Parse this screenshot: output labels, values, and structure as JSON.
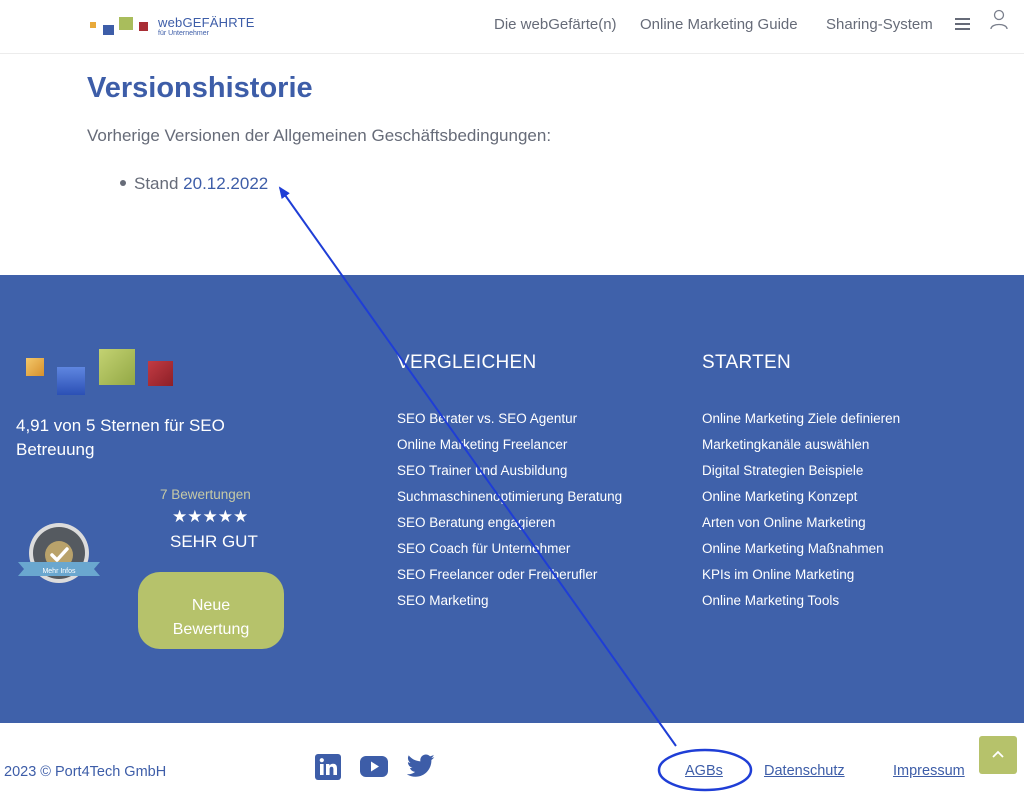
{
  "header": {
    "logo_title": "webGEFÄHRTE",
    "logo_subtitle": "für Unternehmer",
    "nav": [
      "Die webGefärte(n)",
      "Online Marketing Guide",
      "Sharing-System"
    ]
  },
  "main": {
    "title": "Versionshistorie",
    "intro": "Vorherige Versionen der Allgemeinen Geschäftsbedingungen:",
    "version_prefix": "Stand ",
    "version_link": "20.12.2022"
  },
  "footer": {
    "rating_text": "4,91 von 5 Sternen für SEO Betreuung",
    "reviews_count": "7 Bewertungen",
    "stars": "★★★★★",
    "verdict": "SEHR GUT",
    "badge_text": "Mehr Infos",
    "new_review_line1": "Neue",
    "new_review_line2": "Bewertung",
    "col1": {
      "heading": "VERGLEICHEN",
      "links": [
        "SEO Berater vs. SEO Agentur",
        "Online Marketing Freelancer",
        "SEO Trainer und Ausbildung",
        "Suchmaschinenoptimierung Beratung",
        "SEO Beratung engagieren",
        "SEO Coach für Unternehmer",
        "SEO Freelancer oder Freiberufler",
        "SEO Marketing"
      ]
    },
    "col2": {
      "heading": "STARTEN",
      "links": [
        "Online Marketing Ziele definieren",
        "Marketingkanäle auswählen",
        "Digital Strategien Beispiele",
        "Online Marketing Konzept",
        "Arten von Online Marketing",
        "Online Marketing Maßnahmen",
        "KPIs im Online Marketing",
        "Online Marketing Tools"
      ]
    }
  },
  "bottom": {
    "copyright": "2023 © Port4Tech GmbH",
    "social": [
      "linkedin-icon",
      "youtube-icon",
      "twitter-icon"
    ],
    "links": [
      "AGBs",
      "Datenschutz",
      "Impressum"
    ]
  },
  "colors": {
    "brand_blue": "#3d5da8",
    "footer_blue": "#3f61aa",
    "accent_green": "#b6c26b",
    "annotation_blue": "#1f3ed6"
  }
}
